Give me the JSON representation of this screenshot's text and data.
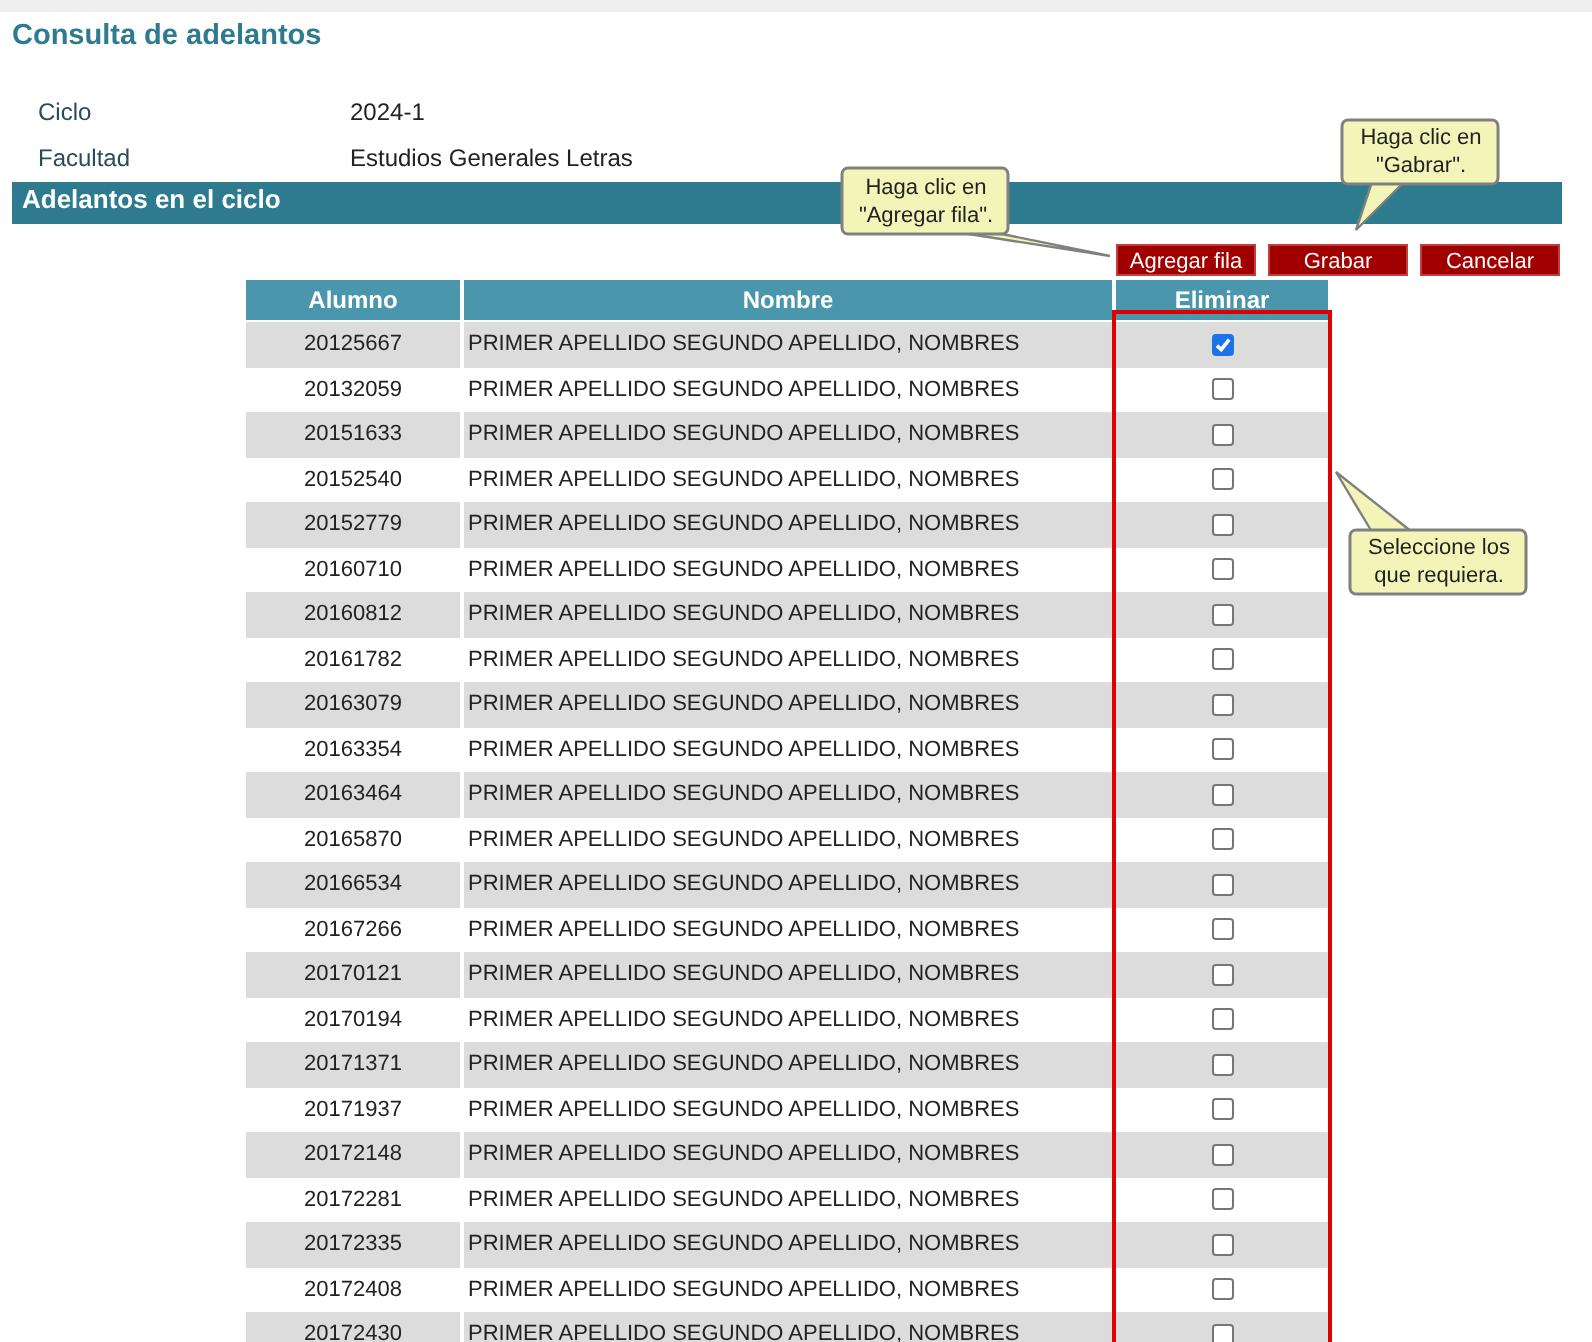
{
  "title": "Consulta de adelantos",
  "fields": [
    {
      "label": "Ciclo",
      "value": "2024-1"
    },
    {
      "label": "Facultad",
      "value": "Estudios Generales Letras"
    }
  ],
  "section": "Adelantos en el ciclo",
  "buttons": [
    "Agregar fila",
    "Grabar",
    "Cancelar"
  ],
  "callouts": [
    {
      "text": "Haga clic en \"Agregar fila\"."
    },
    {
      "text": "Haga clic en \"Gabrar\"."
    },
    {
      "text": "Seleccione los que requiera."
    }
  ],
  "table": {
    "columns": [
      "Alumno",
      "Nombre",
      "Eliminar"
    ],
    "rows": [
      {
        "alumno": "20125667",
        "nombre": "PRIMER APELLIDO SEGUNDO APELLIDO, NOMBRES",
        "checked": true
      },
      {
        "alumno": "20132059",
        "nombre": "PRIMER APELLIDO SEGUNDO APELLIDO, NOMBRES",
        "checked": false
      },
      {
        "alumno": "20151633",
        "nombre": "PRIMER APELLIDO SEGUNDO APELLIDO, NOMBRES",
        "checked": false
      },
      {
        "alumno": "20152540",
        "nombre": "PRIMER APELLIDO SEGUNDO APELLIDO, NOMBRES",
        "checked": false
      },
      {
        "alumno": "20152779",
        "nombre": "PRIMER APELLIDO SEGUNDO APELLIDO, NOMBRES",
        "checked": false
      },
      {
        "alumno": "20160710",
        "nombre": "PRIMER APELLIDO SEGUNDO APELLIDO, NOMBRES",
        "checked": false
      },
      {
        "alumno": "20160812",
        "nombre": "PRIMER APELLIDO SEGUNDO APELLIDO, NOMBRES",
        "checked": false
      },
      {
        "alumno": "20161782",
        "nombre": "PRIMER APELLIDO SEGUNDO APELLIDO, NOMBRES",
        "checked": false
      },
      {
        "alumno": "20163079",
        "nombre": "PRIMER APELLIDO SEGUNDO APELLIDO, NOMBRES",
        "checked": false
      },
      {
        "alumno": "20163354",
        "nombre": "PRIMER APELLIDO SEGUNDO APELLIDO, NOMBRES",
        "checked": false
      },
      {
        "alumno": "20163464",
        "nombre": "PRIMER APELLIDO SEGUNDO APELLIDO, NOMBRES",
        "checked": false
      },
      {
        "alumno": "20165870",
        "nombre": "PRIMER APELLIDO SEGUNDO APELLIDO, NOMBRES",
        "checked": false
      },
      {
        "alumno": "20166534",
        "nombre": "PRIMER APELLIDO SEGUNDO APELLIDO, NOMBRES",
        "checked": false
      },
      {
        "alumno": "20167266",
        "nombre": "PRIMER APELLIDO SEGUNDO APELLIDO, NOMBRES",
        "checked": false
      },
      {
        "alumno": "20170121",
        "nombre": "PRIMER APELLIDO SEGUNDO APELLIDO, NOMBRES",
        "checked": false
      },
      {
        "alumno": "20170194",
        "nombre": "PRIMER APELLIDO SEGUNDO APELLIDO, NOMBRES",
        "checked": false
      },
      {
        "alumno": "20171371",
        "nombre": "PRIMER APELLIDO SEGUNDO APELLIDO, NOMBRES",
        "checked": false
      },
      {
        "alumno": "20171937",
        "nombre": "PRIMER APELLIDO SEGUNDO APELLIDO, NOMBRES",
        "checked": false
      },
      {
        "alumno": "20172148",
        "nombre": "PRIMER APELLIDO SEGUNDO APELLIDO, NOMBRES",
        "checked": false
      },
      {
        "alumno": "20172281",
        "nombre": "PRIMER APELLIDO SEGUNDO APELLIDO, NOMBRES",
        "checked": false
      },
      {
        "alumno": "20172335",
        "nombre": "PRIMER APELLIDO SEGUNDO APELLIDO, NOMBRES",
        "checked": false
      },
      {
        "alumno": "20172408",
        "nombre": "PRIMER APELLIDO SEGUNDO APELLIDO, NOMBRES",
        "checked": false
      },
      {
        "alumno": "20172430",
        "nombre": "PRIMER APELLIDO SEGUNDO APELLIDO, NOMBRES",
        "checked": false
      }
    ]
  }
}
